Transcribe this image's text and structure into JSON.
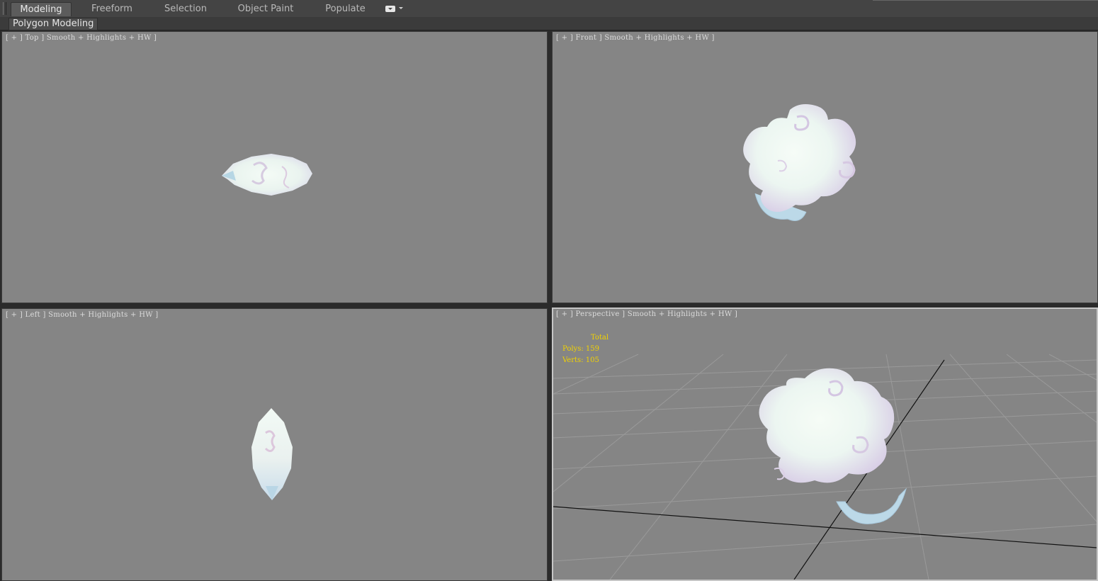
{
  "ribbon": {
    "tabs": [
      {
        "label": "Modeling",
        "active": true
      },
      {
        "label": "Freeform",
        "active": false
      },
      {
        "label": "Selection",
        "active": false
      },
      {
        "label": "Object Paint",
        "active": false
      },
      {
        "label": "Populate",
        "active": false
      }
    ],
    "extras_icon": "toggle-icon",
    "panel_label": "Polygon Modeling"
  },
  "viewports": {
    "top": {
      "label": "[ + ] Top ] Smooth + Highlights + HW ]"
    },
    "front": {
      "label": "[ + ] Front ] Smooth + Highlights + HW ]"
    },
    "left": {
      "label": "[ + ] Left ] Smooth + Highlights + HW ]"
    },
    "perspective": {
      "label": "[ + ] Perspective ] Smooth + Highlights + HW ]"
    }
  },
  "stats": {
    "total_label": "Total",
    "polys_label": "Polys:",
    "polys_value": "159",
    "verts_label": "Verts:",
    "verts_value": "105",
    "color": "#f2d200"
  },
  "colors": {
    "viewport_bg": "#858585",
    "active_viewport_border": "#c6c6c6",
    "grid_line": "#9a9a9a",
    "grid_axis": "#111111"
  }
}
